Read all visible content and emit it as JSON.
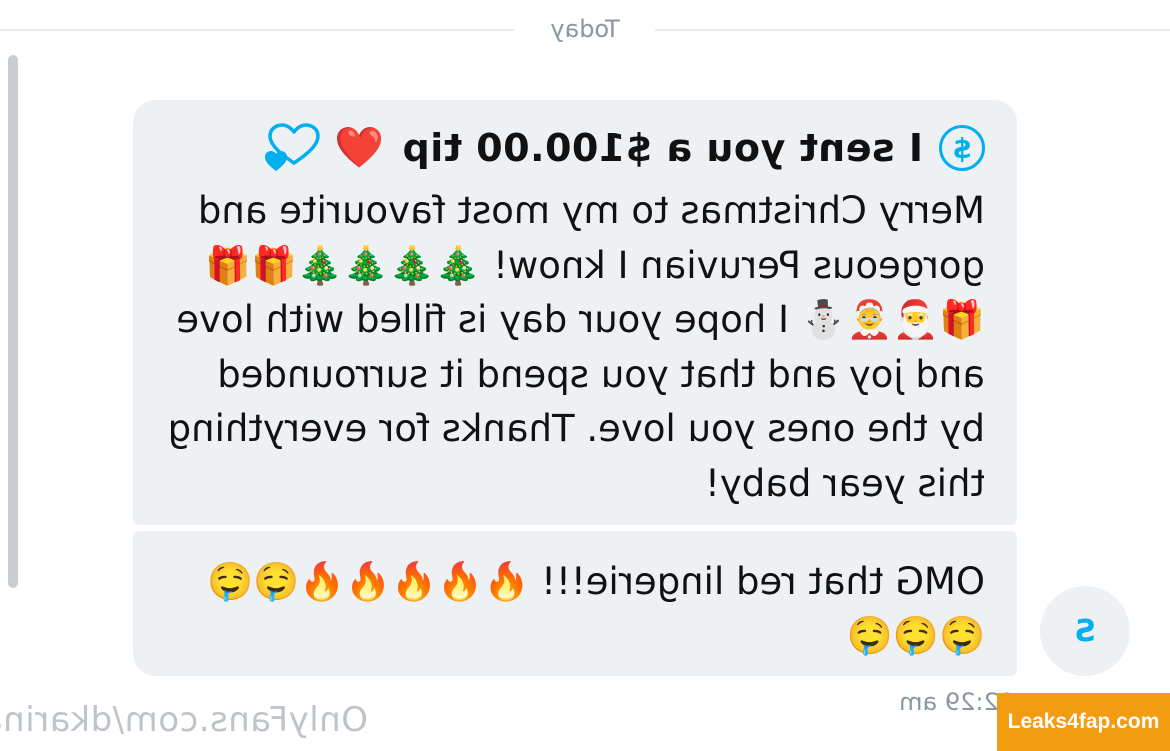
{
  "divider": {
    "label": "Today"
  },
  "sender": {
    "avatar_initial": "S"
  },
  "messages": {
    "tip": {
      "text": "I sent you a $100.00 tip",
      "currency_icon": "$",
      "heart": "❤️",
      "icon_names": [
        "dollar-circle-icon",
        "red-heart-emoji",
        "hearts-outline-icon"
      ],
      "accent_color": "#00aff0"
    },
    "christmas": {
      "text": "Merry Christmas to my most favourite and gorgeous Peruvian I know! 🎄🎄🎄🎄🎁🎁🎁🎅🤶⛄ I hope your day is filled with love and joy and that you spend it surrounded by the ones you love. Thanks for everything this year baby!"
    },
    "lingerie": {
      "text": "OMG that red lingerie!!! 🔥🔥🔥🔥🔥🤤🤤🤤🤤🤤"
    },
    "time": "12:29 am"
  },
  "watermark": {
    "site": "OnlyFans.com/dkarina",
    "badge": "Leaks4fap.com",
    "badge_color": "#f39c12"
  }
}
